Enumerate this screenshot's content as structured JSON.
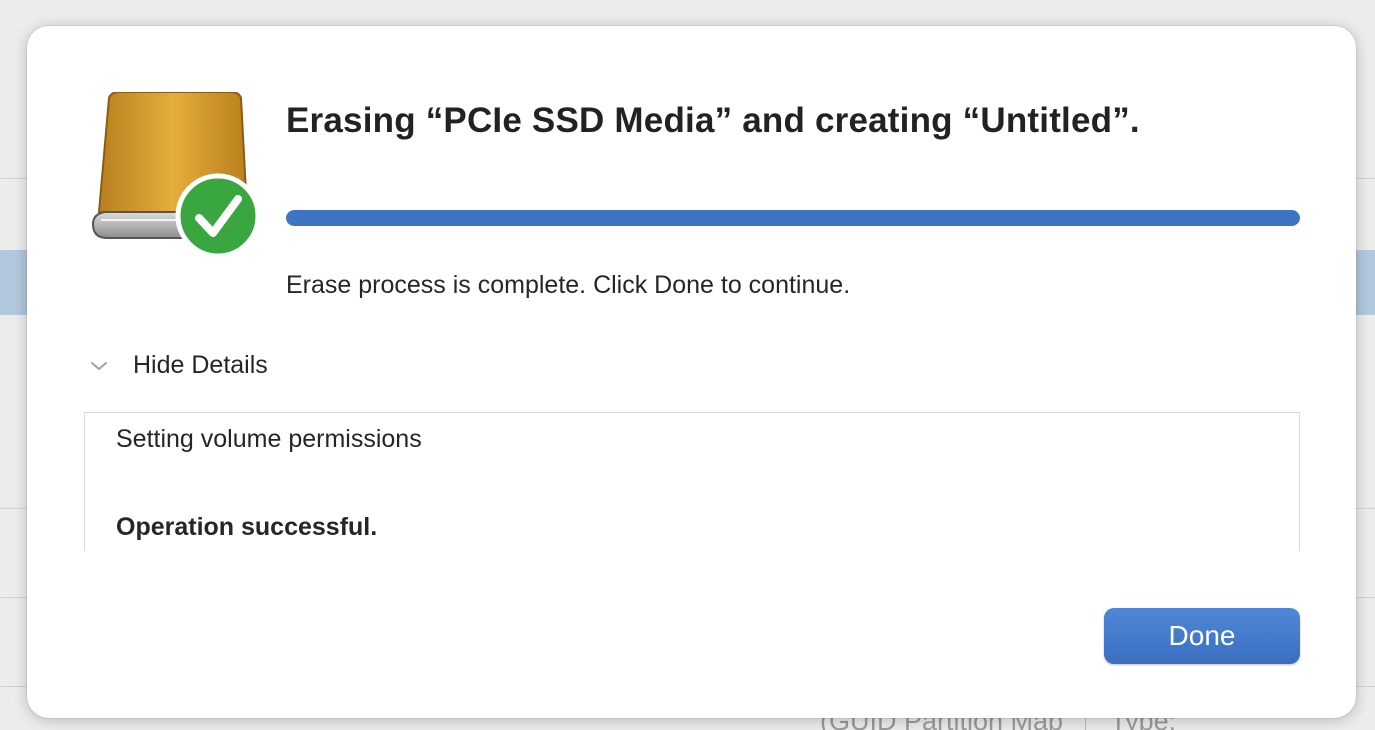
{
  "dialog": {
    "title": "Erasing “PCIe SSD Media” and creating “Untitled”.",
    "progress_fraction": 1.0,
    "status_message": "Erase process is complete. Click Done to continue.",
    "details_toggle_label": "Hide Details",
    "log_lines": [
      "Setting volume permissions",
      "Operation successful."
    ],
    "done_label": "Done",
    "icons": {
      "drive": "external-drive-icon",
      "badge": "checkmark-badge-icon",
      "toggle": "chevron-down-icon"
    },
    "colors": {
      "accent": "#3f74c2",
      "drive_body": "#d99a2a",
      "badge_green": "#3aa63f"
    }
  },
  "background": {
    "partial_text_1": "(GUID Partition Map",
    "partial_text_2": "Type:"
  }
}
